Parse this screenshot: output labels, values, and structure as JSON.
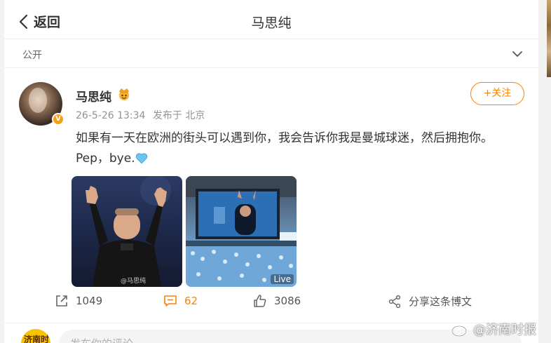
{
  "header": {
    "back_label": "返回",
    "title": "马思纯"
  },
  "privacy": {
    "label": "公开"
  },
  "post": {
    "username": "马思纯",
    "verified_badge": "V",
    "timestamp": "26-5-26 13:34",
    "location": "发布于 北京",
    "follow_label": "+关注",
    "text_line1": "如果有一天在欧洲的街头可以遇到你，我会告诉你我是曼城球迷，然后拥抱你。",
    "text_line2": "Pep，bye.",
    "photo1_watermark": "@马思纯",
    "photo2_live_label": "Live"
  },
  "actions": {
    "repost_count": "1049",
    "comment_count": "62",
    "like_count": "3086",
    "share_label": "分享这条博文"
  },
  "comment_box": {
    "avatar_text": "济南时报",
    "placeholder": "发布你的评论"
  },
  "watermark": {
    "text": "@济南时报"
  },
  "colors": {
    "accent": "#ff8200",
    "badge": "#f7a11a",
    "heart": "#6fc3f0"
  }
}
